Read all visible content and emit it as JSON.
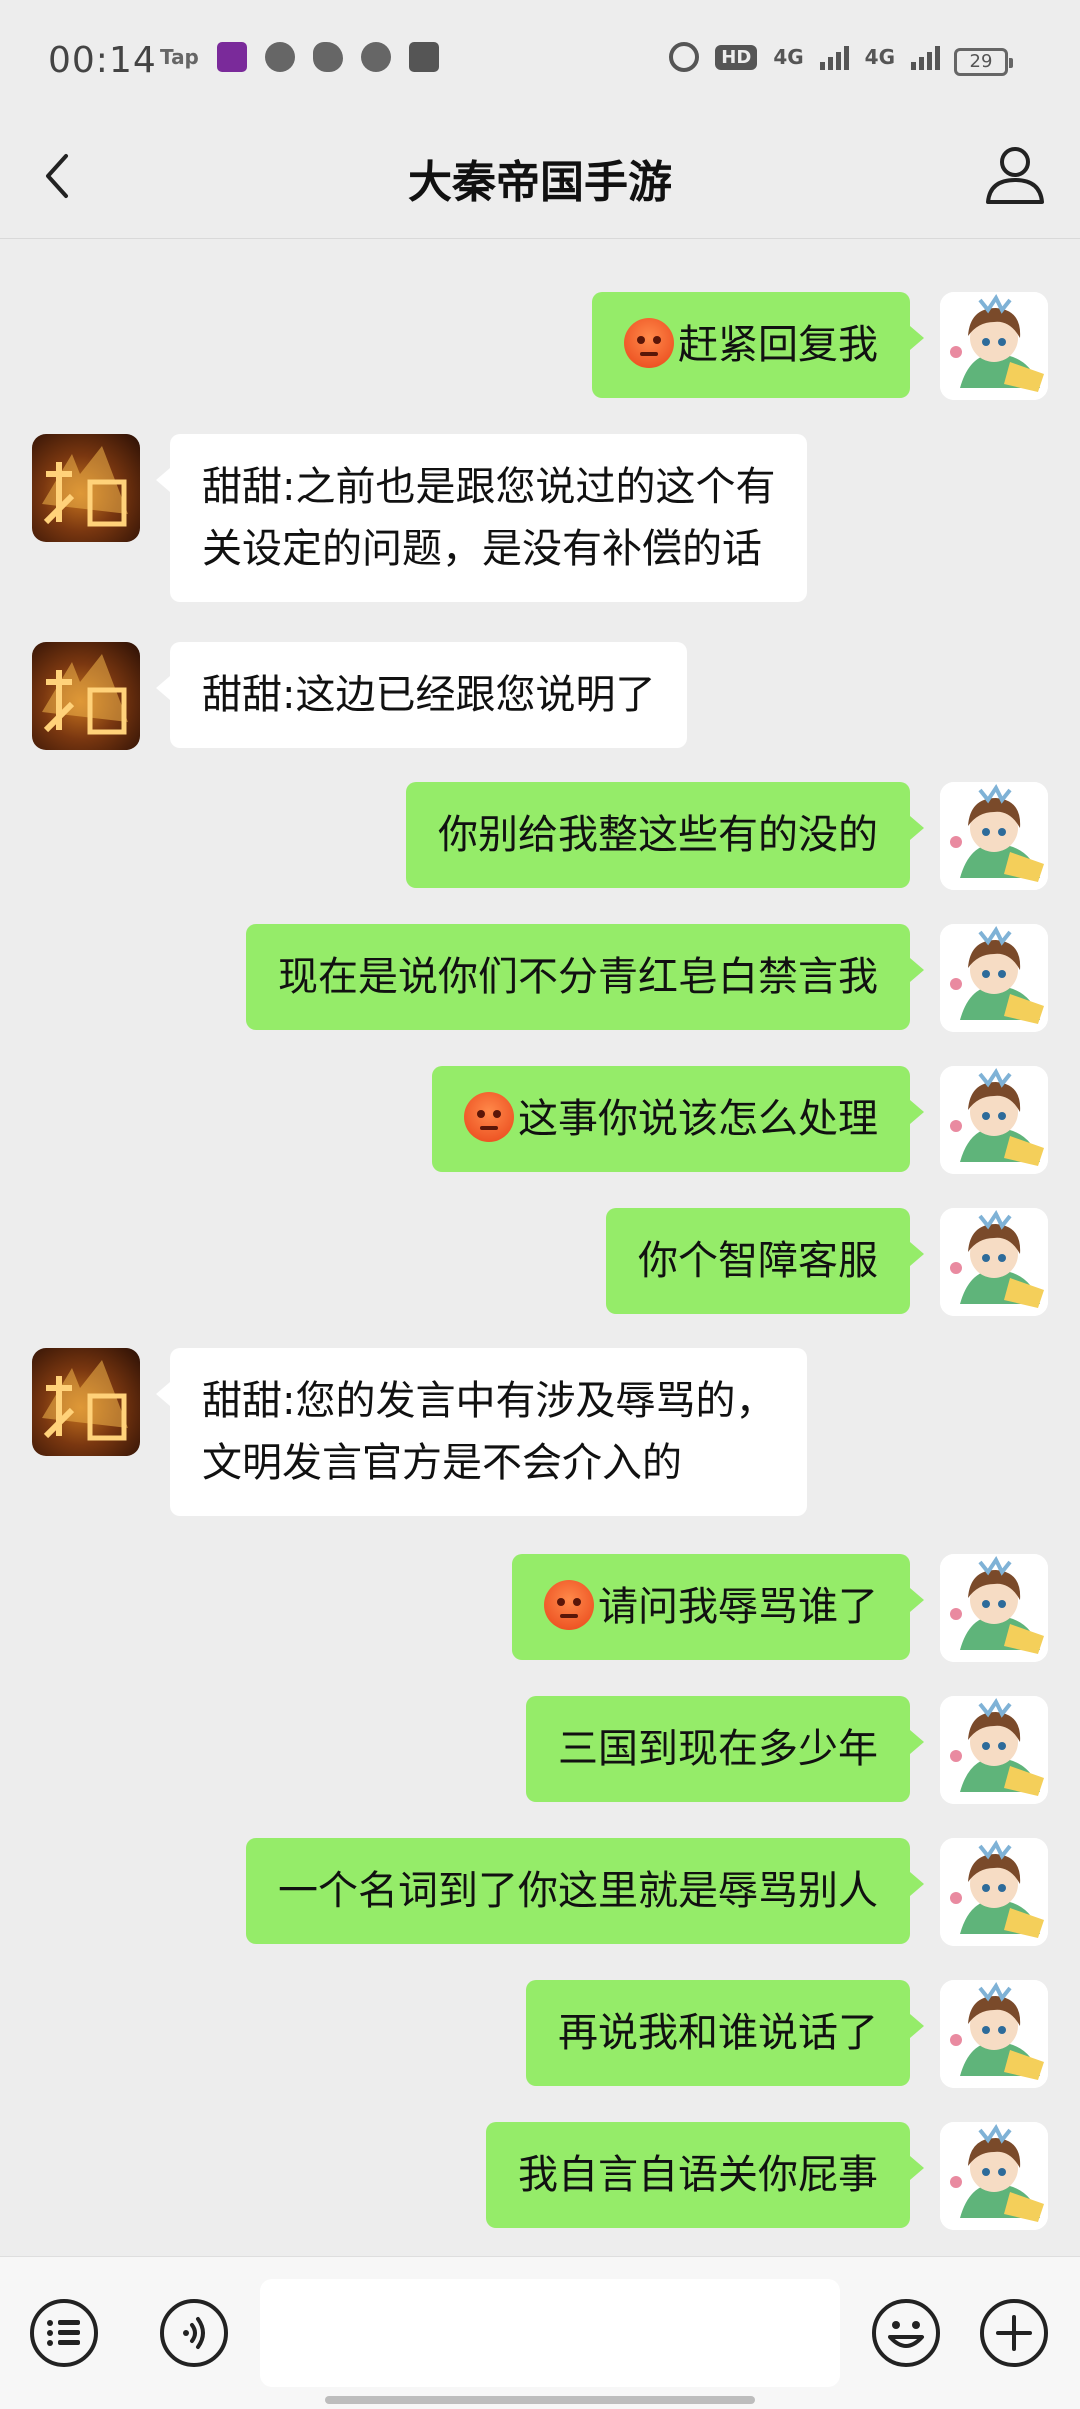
{
  "status_bar": {
    "time": "00:14",
    "tap_label": "Tap",
    "hd_label": "HD",
    "net1": "4G",
    "net2": "4G",
    "battery": "29"
  },
  "header": {
    "title": "大秦帝国手游"
  },
  "messages": [
    {
      "from": "me",
      "emoji": "angry",
      "text": "赶紧回复我"
    },
    {
      "from": "them",
      "lines": [
        "甜甜:之前也是跟您说过的这个有",
        "关设定的问题，是没有补偿的话"
      ]
    },
    {
      "from": "them",
      "lines": [
        "甜甜:这边已经跟您说明了"
      ]
    },
    {
      "from": "me",
      "text": "你别给我整这些有的没的"
    },
    {
      "from": "me",
      "text": "现在是说你们不分青红皂白禁言我"
    },
    {
      "from": "me",
      "emoji": "angry",
      "text": "这事你说该怎么处理"
    },
    {
      "from": "me",
      "text": "你个智障客服"
    },
    {
      "from": "them",
      "lines": [
        "甜甜:您的发言中有涉及辱骂的，",
        "文明发言官方是不会介入的"
      ]
    },
    {
      "from": "me",
      "emoji": "angry",
      "text": "请问我辱骂谁了"
    },
    {
      "from": "me",
      "text": "三国到现在多少年"
    },
    {
      "from": "me",
      "text": "一个名词到了你这里就是辱骂别人"
    },
    {
      "from": "me",
      "text": "再说我和谁说话了"
    },
    {
      "from": "me",
      "text": "我自言自语关你屁事"
    }
  ],
  "icons": {
    "back": "chevron-left-icon",
    "profile": "person-icon",
    "menu": "list-icon",
    "voice": "voice-icon",
    "emoji": "smiley-icon",
    "plus": "plus-icon"
  }
}
